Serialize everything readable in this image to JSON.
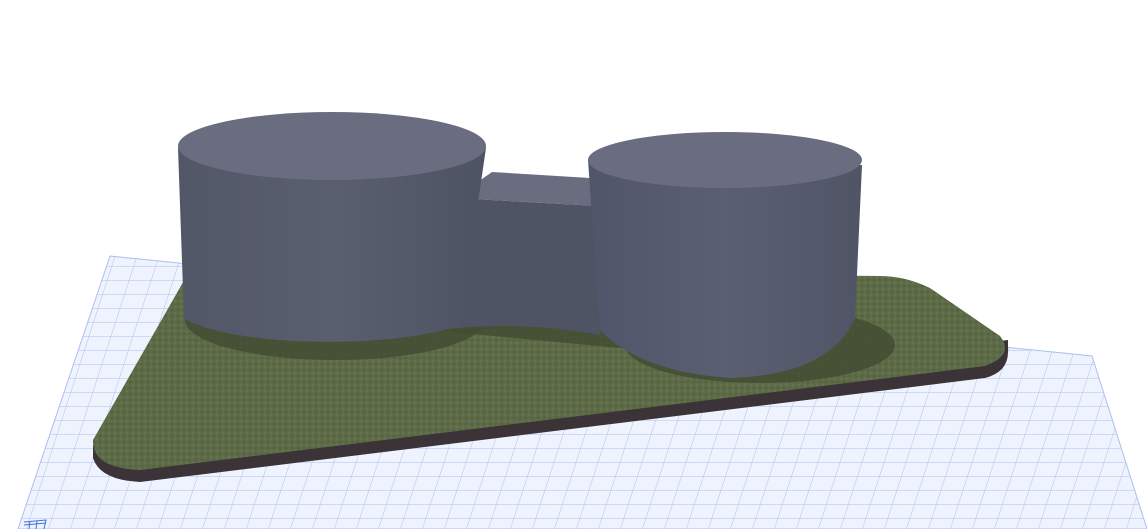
{
  "viewport": {
    "mode": "3D view",
    "colors": {
      "background": "#ffffff",
      "grid_fill": "#eef3fd",
      "grid_line": "#a9c0ef",
      "slab_top": "#5c6a45",
      "slab_edge": "#3b3338",
      "building_top": "#6a6d80",
      "building_side": "#555a6a",
      "shadow": "#414a33"
    },
    "icons": [
      "grid-navigator-icon"
    ]
  }
}
